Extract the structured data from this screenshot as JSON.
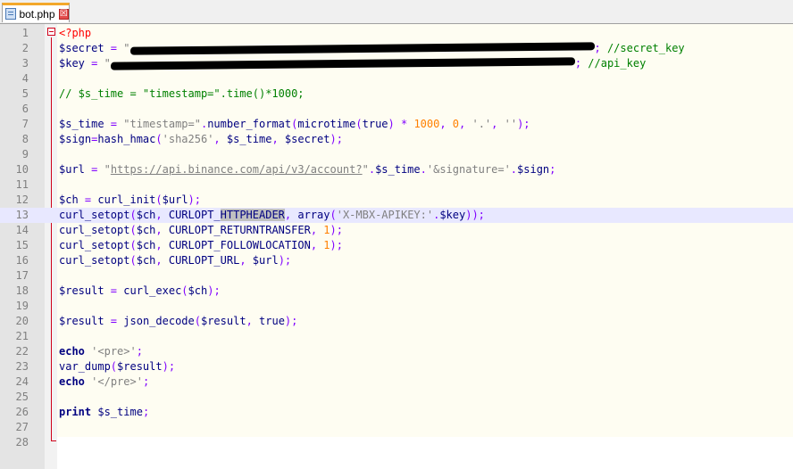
{
  "tab": {
    "title": "bot.php",
    "close_glyph": "☒"
  },
  "lines": [
    {
      "n": "1",
      "parts": [
        {
          "t": "<?php",
          "c": "tag"
        }
      ]
    },
    {
      "n": "2",
      "parts": [
        {
          "t": "$secret",
          "c": "var"
        },
        {
          "t": " = ",
          "c": "op"
        },
        {
          "t": "\"",
          "c": "str"
        },
        {
          "t": "REDACTED",
          "c": "redact",
          "w": 520
        },
        {
          "t": "; ",
          "c": "op"
        },
        {
          "t": "//secret_key",
          "c": "com"
        }
      ]
    },
    {
      "n": "3",
      "parts": [
        {
          "t": "$key",
          "c": "var"
        },
        {
          "t": " = ",
          "c": "op"
        },
        {
          "t": "\"",
          "c": "str"
        },
        {
          "t": "REDACTED",
          "c": "redact",
          "w": 520
        },
        {
          "t": "; ",
          "c": "op"
        },
        {
          "t": "//api_key",
          "c": "com"
        }
      ]
    },
    {
      "n": "4",
      "parts": []
    },
    {
      "n": "5",
      "parts": [
        {
          "t": "// $s_time = \"timestamp=\".time()*1000;",
          "c": "com"
        }
      ]
    },
    {
      "n": "6",
      "parts": []
    },
    {
      "n": "7",
      "parts": [
        {
          "t": "$s_time",
          "c": "var"
        },
        {
          "t": " = ",
          "c": "op"
        },
        {
          "t": "\"timestamp=\"",
          "c": "str"
        },
        {
          "t": ".",
          "c": "op"
        },
        {
          "t": "number_format",
          "c": "fn"
        },
        {
          "t": "(",
          "c": "op"
        },
        {
          "t": "microtime",
          "c": "fn"
        },
        {
          "t": "(",
          "c": "op"
        },
        {
          "t": "true",
          "c": "fn"
        },
        {
          "t": ") * ",
          "c": "op"
        },
        {
          "t": "1000",
          "c": "num"
        },
        {
          "t": ", ",
          "c": "op"
        },
        {
          "t": "0",
          "c": "num"
        },
        {
          "t": ", ",
          "c": "op"
        },
        {
          "t": "'.'",
          "c": "str"
        },
        {
          "t": ", ",
          "c": "op"
        },
        {
          "t": "''",
          "c": "str"
        },
        {
          "t": ");",
          "c": "op"
        }
      ]
    },
    {
      "n": "8",
      "parts": [
        {
          "t": "$sign",
          "c": "var"
        },
        {
          "t": "=",
          "c": "op"
        },
        {
          "t": "hash_hmac",
          "c": "fn"
        },
        {
          "t": "(",
          "c": "op"
        },
        {
          "t": "'sha256'",
          "c": "str"
        },
        {
          "t": ", ",
          "c": "op"
        },
        {
          "t": "$s_time",
          "c": "var"
        },
        {
          "t": ", ",
          "c": "op"
        },
        {
          "t": "$secret",
          "c": "var"
        },
        {
          "t": ");",
          "c": "op"
        }
      ]
    },
    {
      "n": "9",
      "parts": []
    },
    {
      "n": "10",
      "parts": [
        {
          "t": "$url",
          "c": "var"
        },
        {
          "t": " = ",
          "c": "op"
        },
        {
          "t": "\"",
          "c": "str"
        },
        {
          "t": "https://api.binance.com/api/v3/account?",
          "c": "url"
        },
        {
          "t": "\"",
          "c": "str"
        },
        {
          "t": ".",
          "c": "op"
        },
        {
          "t": "$s_time",
          "c": "var"
        },
        {
          "t": ".",
          "c": "op"
        },
        {
          "t": "'&signature='",
          "c": "str"
        },
        {
          "t": ".",
          "c": "op"
        },
        {
          "t": "$sign",
          "c": "var"
        },
        {
          "t": ";",
          "c": "op"
        }
      ]
    },
    {
      "n": "11",
      "parts": []
    },
    {
      "n": "12",
      "parts": [
        {
          "t": "$ch",
          "c": "var"
        },
        {
          "t": " = ",
          "c": "op"
        },
        {
          "t": "curl_init",
          "c": "fn"
        },
        {
          "t": "(",
          "c": "op"
        },
        {
          "t": "$url",
          "c": "var"
        },
        {
          "t": ");",
          "c": "op"
        }
      ]
    },
    {
      "n": "13",
      "current": true,
      "parts": [
        {
          "t": "curl_setopt",
          "c": "fn"
        },
        {
          "t": "(",
          "c": "op"
        },
        {
          "t": "$ch",
          "c": "var"
        },
        {
          "t": ", ",
          "c": "op"
        },
        {
          "t": "CURLOPT_",
          "c": "fn"
        },
        {
          "t": "HTTPHEADER",
          "c": "sel"
        },
        {
          "t": ", ",
          "c": "op"
        },
        {
          "t": "array",
          "c": "fn"
        },
        {
          "t": "(",
          "c": "op"
        },
        {
          "t": "'X-MBX-APIKEY:'",
          "c": "str"
        },
        {
          "t": ".",
          "c": "op"
        },
        {
          "t": "$key",
          "c": "var"
        },
        {
          "t": "));",
          "c": "op"
        }
      ]
    },
    {
      "n": "14",
      "parts": [
        {
          "t": "curl_setopt",
          "c": "fn"
        },
        {
          "t": "(",
          "c": "op"
        },
        {
          "t": "$ch",
          "c": "var"
        },
        {
          "t": ", ",
          "c": "op"
        },
        {
          "t": "CURLOPT_RETURNTRANSFER",
          "c": "fn"
        },
        {
          "t": ", ",
          "c": "op"
        },
        {
          "t": "1",
          "c": "num"
        },
        {
          "t": ");",
          "c": "op"
        }
      ]
    },
    {
      "n": "15",
      "parts": [
        {
          "t": "curl_setopt",
          "c": "fn"
        },
        {
          "t": "(",
          "c": "op"
        },
        {
          "t": "$ch",
          "c": "var"
        },
        {
          "t": ", ",
          "c": "op"
        },
        {
          "t": "CURLOPT_FOLLOWLOCATION",
          "c": "fn"
        },
        {
          "t": ", ",
          "c": "op"
        },
        {
          "t": "1",
          "c": "num"
        },
        {
          "t": ");",
          "c": "op"
        }
      ]
    },
    {
      "n": "16",
      "parts": [
        {
          "t": "curl_setopt",
          "c": "fn"
        },
        {
          "t": "(",
          "c": "op"
        },
        {
          "t": "$ch",
          "c": "var"
        },
        {
          "t": ", ",
          "c": "op"
        },
        {
          "t": "CURLOPT_URL",
          "c": "fn"
        },
        {
          "t": ", ",
          "c": "op"
        },
        {
          "t": "$url",
          "c": "var"
        },
        {
          "t": ");",
          "c": "op"
        }
      ]
    },
    {
      "n": "17",
      "parts": []
    },
    {
      "n": "18",
      "parts": [
        {
          "t": "$result",
          "c": "var"
        },
        {
          "t": " = ",
          "c": "op"
        },
        {
          "t": "curl_exec",
          "c": "fn"
        },
        {
          "t": "(",
          "c": "op"
        },
        {
          "t": "$ch",
          "c": "var"
        },
        {
          "t": ");",
          "c": "op"
        }
      ]
    },
    {
      "n": "19",
      "parts": []
    },
    {
      "n": "20",
      "parts": [
        {
          "t": "$result",
          "c": "var"
        },
        {
          "t": " = ",
          "c": "op"
        },
        {
          "t": "json_decode",
          "c": "fn"
        },
        {
          "t": "(",
          "c": "op"
        },
        {
          "t": "$result",
          "c": "var"
        },
        {
          "t": ", ",
          "c": "op"
        },
        {
          "t": "true",
          "c": "fn"
        },
        {
          "t": ");",
          "c": "op"
        }
      ]
    },
    {
      "n": "21",
      "parts": []
    },
    {
      "n": "22",
      "parts": [
        {
          "t": "echo",
          "c": "kw"
        },
        {
          "t": " ",
          "c": "op"
        },
        {
          "t": "'<pre>'",
          "c": "str"
        },
        {
          "t": ";",
          "c": "op"
        }
      ]
    },
    {
      "n": "23",
      "parts": [
        {
          "t": "var_dump",
          "c": "fn"
        },
        {
          "t": "(",
          "c": "op"
        },
        {
          "t": "$result",
          "c": "var"
        },
        {
          "t": ");",
          "c": "op"
        }
      ]
    },
    {
      "n": "24",
      "parts": [
        {
          "t": "echo",
          "c": "kw"
        },
        {
          "t": " ",
          "c": "op"
        },
        {
          "t": "'</pre>'",
          "c": "str"
        },
        {
          "t": ";",
          "c": "op"
        }
      ]
    },
    {
      "n": "25",
      "parts": []
    },
    {
      "n": "26",
      "parts": [
        {
          "t": "print",
          "c": "kw"
        },
        {
          "t": " ",
          "c": "op"
        },
        {
          "t": "$s_time",
          "c": "var"
        },
        {
          "t": ";",
          "c": "op"
        }
      ]
    },
    {
      "n": "27",
      "parts": []
    },
    {
      "n": "28",
      "parts": []
    }
  ]
}
